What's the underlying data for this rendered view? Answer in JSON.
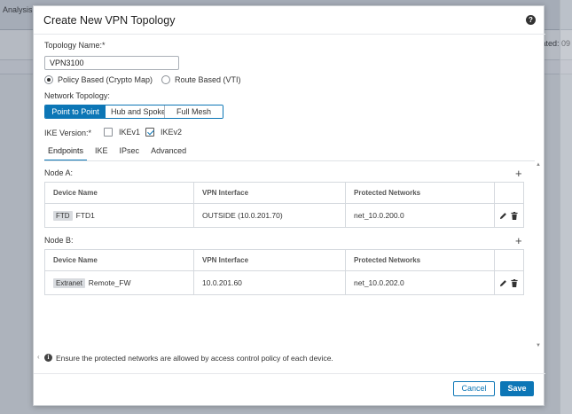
{
  "background": {
    "menu_items": [
      "Analysis"
    ],
    "right_text": "ated: 09"
  },
  "modal": {
    "title": "Create New VPN Topology",
    "help_icon": "question-circle-icon",
    "topology_name_label": "Topology Name:*",
    "topology_name_value": "VPN3100",
    "radios": [
      {
        "label": "Policy Based (Crypto Map)",
        "selected": true
      },
      {
        "label": "Route Based (VTI)",
        "selected": false
      }
    ],
    "network_topology_label": "Network Topology:",
    "network_topology_options": [
      {
        "label": "Point to Point",
        "active": true
      },
      {
        "label": "Hub and Spoke",
        "active": false
      },
      {
        "label": "Full Mesh",
        "active": false
      }
    ],
    "ike_version_label": "IKE Version:*",
    "ike_options": [
      {
        "label": "IKEv1",
        "checked": false
      },
      {
        "label": "IKEv2",
        "checked": true
      }
    ],
    "tabs": [
      {
        "label": "Endpoints",
        "active": true
      },
      {
        "label": "IKE",
        "active": false
      },
      {
        "label": "IPsec",
        "active": false
      },
      {
        "label": "Advanced",
        "active": false
      }
    ],
    "columns": [
      "Device Name",
      "VPN Interface",
      "Protected Networks"
    ],
    "node_a": {
      "label": "Node A:",
      "row": {
        "tag": "FTD",
        "device": "FTD1",
        "interface": "OUTSIDE (10.0.201.70)",
        "networks": "net_10.0.200.0"
      }
    },
    "node_b": {
      "label": "Node B:",
      "row": {
        "tag": "Extranet",
        "device": "Remote_FW",
        "interface": "10.0.201.60",
        "networks": "net_10.0.202.0"
      }
    },
    "info_text": "Ensure the protected networks are allowed by access control policy of each device.",
    "cancel_label": "Cancel",
    "save_label": "Save"
  },
  "colors": {
    "accent": "#0c76b6"
  }
}
